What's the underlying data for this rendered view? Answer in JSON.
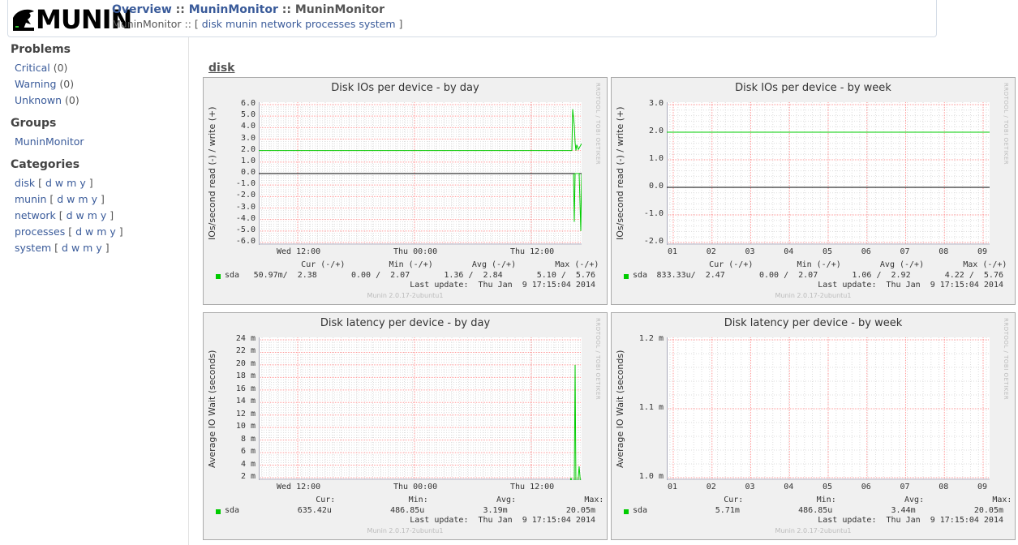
{
  "header": {
    "logo_text": "MUNIN",
    "crumb_overview": "Overview",
    "crumb_sep1": " :: ",
    "crumb_group": "MuninMonitor",
    "crumb_sep2": " :: ",
    "crumb_host": "MuninMonitor",
    "sub_host": "MuninMonitor",
    "sub_sep": " :: [ ",
    "sub_links": [
      "disk",
      "munin",
      "network",
      "processes",
      "system"
    ],
    "sub_end": " ]"
  },
  "sidebar": {
    "problems_heading": "Problems",
    "problems": [
      {
        "label": "Critical",
        "count": " (0)"
      },
      {
        "label": "Warning",
        "count": " (0)"
      },
      {
        "label": "Unknown",
        "count": " (0)"
      }
    ],
    "groups_heading": "Groups",
    "groups": [
      "MuninMonitor"
    ],
    "categories_heading": "Categories",
    "categories": [
      {
        "label": "disk"
      },
      {
        "label": "munin"
      },
      {
        "label": "network"
      },
      {
        "label": "processes"
      },
      {
        "label": "system"
      }
    ],
    "period_open": " [ ",
    "period_close": " ]",
    "periods": [
      "d",
      "w",
      "m",
      "y"
    ]
  },
  "main": {
    "section_title": "disk",
    "side_text": "RRDTOOL / TOBI OETIKER",
    "version_text": "Munin 2.0.17-2ubuntu1",
    "series_name": "sda",
    "last_update": "Last update:  Thu Jan  9 17:15:04 2014"
  },
  "colors": {
    "series": "#00cc00",
    "zero": "#000000",
    "grid_major": "#ff9999",
    "grid_minor": "#dddddd"
  },
  "graphs": [
    {
      "title": "Disk IOs per device - by day",
      "ylabel": "IOs/second read (-) / write (+)",
      "yticks": [
        "6.0",
        "5.0",
        "4.0",
        "3.0",
        "2.0",
        "1.0",
        "0.0",
        "-1.0",
        "-2.0",
        "-3.0",
        "-4.0",
        "-5.0",
        "-6.0"
      ],
      "xticks": [
        "Wed 12:00",
        "Thu 00:00",
        "Thu 12:00"
      ],
      "legend_head": "         Cur (-/+)         Min (-/+)        Avg (-/+)        Max (-/+)",
      "legend_row": "50.97m/  2.38       0.00 /  2.07       1.36 /  2.84       5.10 /  5.76"
    },
    {
      "title": "Disk IOs per device - by week",
      "ylabel": "IOs/second read (-) / write (+)",
      "yticks": [
        "3.0",
        "2.0",
        "1.0",
        "0.0",
        "-1.0",
        "-2.0"
      ],
      "xticks": [
        "01",
        "02",
        "03",
        "04",
        "05",
        "06",
        "07",
        "08",
        "09"
      ],
      "legend_head": "         Cur (-/+)         Min (-/+)        Avg (-/+)        Max (-/+)",
      "legend_row": "833.33u/  2.47       0.00 /  2.07       1.06 /  2.92       4.22 /  5.76"
    },
    {
      "title": "Disk latency per device - by day",
      "ylabel": "Average IO Wait (seconds)",
      "yticks": [
        "24 m",
        "22 m",
        "20 m",
        "18 m",
        "16 m",
        "14 m",
        "12 m",
        "10 m",
        "8 m",
        "6 m",
        "4 m",
        "2 m"
      ],
      "xticks": [
        "Wed 12:00",
        "Thu 00:00",
        "Thu 12:00"
      ],
      "legend_head": "            Cur:               Min:              Avg:              Max:",
      "legend_row": "635.42u            486.85u            3.19m            20.05m"
    },
    {
      "title": "Disk latency per device - by week",
      "ylabel": "Average IO Wait (seconds)",
      "yticks": [
        "1.2 m",
        "1.1 m",
        "1.0 m"
      ],
      "xticks": [
        "01",
        "02",
        "03",
        "04",
        "05",
        "06",
        "07",
        "08",
        "09"
      ],
      "legend_head": "            Cur:               Min:              Avg:              Max:",
      "legend_row": "5.71m            486.85u            3.44m            20.05m"
    }
  ]
}
